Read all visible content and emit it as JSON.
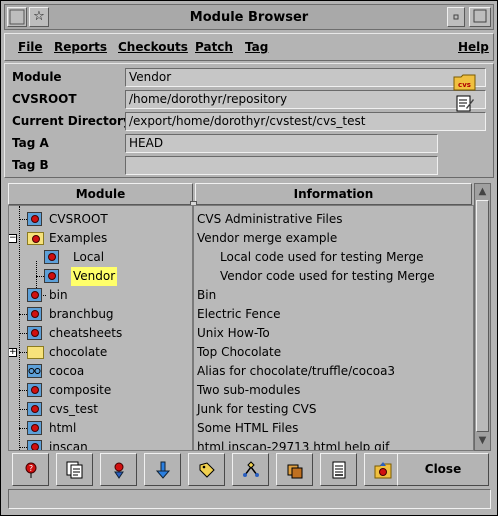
{
  "window": {
    "title": "Module Browser"
  },
  "menu": [
    {
      "label": "File"
    },
    {
      "label": "Reports"
    },
    {
      "label": "Checkouts"
    },
    {
      "label": "Patch"
    },
    {
      "label": "Tag"
    },
    {
      "label": "Help"
    }
  ],
  "fields": {
    "module": {
      "label": "Module",
      "value": "Vendor"
    },
    "cvsroot": {
      "label": "CVSROOT",
      "value": "/home/dorothyr/repository"
    },
    "current_directory": {
      "label": "Current Directory",
      "value": "/export/home/dorothyr/cvstest/cvs_test"
    },
    "tag_a": {
      "label": "Tag A",
      "value": "HEAD"
    },
    "tag_b": {
      "label": "Tag B",
      "value": ""
    }
  },
  "cvs_badge": "cvs",
  "columns": {
    "module": "Module",
    "information": "Information"
  },
  "rows": [
    {
      "name": "CVSROOT",
      "info": "CVS Administrative Files",
      "icon": "module-icon"
    },
    {
      "name": "Examples",
      "info": "Vendor merge example",
      "icon": "open-folder-icon"
    },
    {
      "name": "Local",
      "info": "Local code used for testing Merge",
      "icon": "module-icon"
    },
    {
      "name": "Vendor",
      "info": "Vendor code used for testing Merge",
      "icon": "module-icon",
      "selected": true
    },
    {
      "name": "bin",
      "info": "Bin",
      "icon": "module-icon"
    },
    {
      "name": "branchbug",
      "info": "Electric Fence",
      "icon": "module-icon"
    },
    {
      "name": "cheatsheets",
      "info": "Unix How-To",
      "icon": "module-icon"
    },
    {
      "name": "chocolate",
      "info": "Top Chocolate",
      "icon": "folder-icon"
    },
    {
      "name": "cocoa",
      "info": "Alias for chocolate/truffle/cocoa3",
      "icon": "alias-icon"
    },
    {
      "name": "composite",
      "info": "Two sub-modules",
      "icon": "module-icon"
    },
    {
      "name": "cvs_test",
      "info": "Junk for testing CVS",
      "icon": "module-icon"
    },
    {
      "name": "html",
      "info": "Some HTML Files",
      "icon": "module-icon"
    },
    {
      "name": "inscan",
      "info": "html inscan-29713 html help gif",
      "icon": "module-icon"
    }
  ],
  "toolbar": {
    "close_label": "Close"
  },
  "status": {
    "text": ""
  }
}
